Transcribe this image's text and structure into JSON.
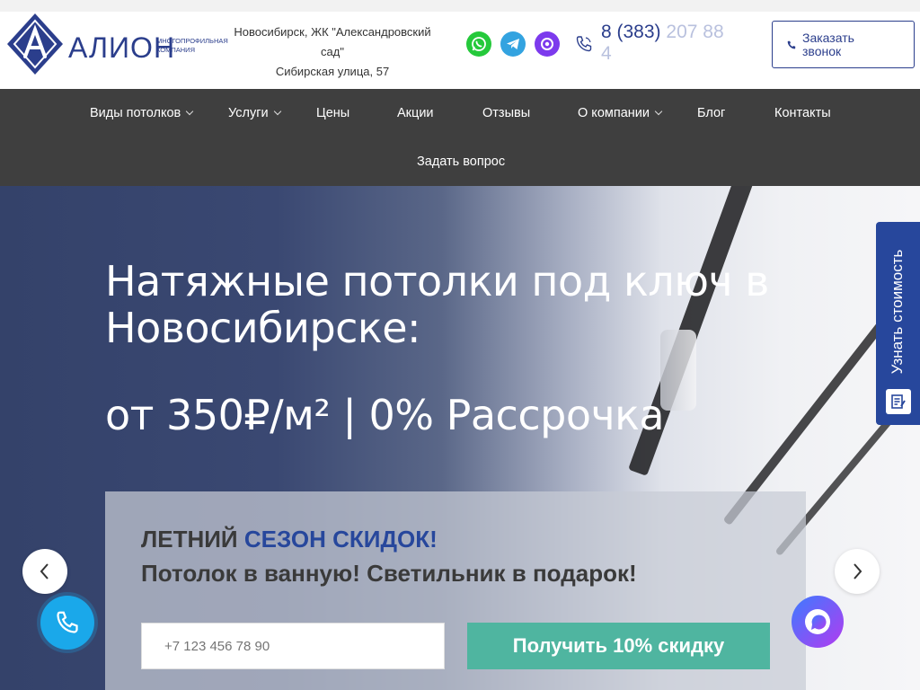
{
  "brand": {
    "name": "АЛИОН",
    "tagline_line1": "многопрофильная",
    "tagline_line2": "компания",
    "primary_color": "#2b3e8c",
    "accent_color": "#27479c"
  },
  "header": {
    "address_line1": "Новосибирск, ЖК \"Александровский сад\"",
    "address_line2": "Сибирская улица, 57",
    "socials": [
      {
        "name": "whatsapp-icon"
      },
      {
        "name": "telegram-icon"
      },
      {
        "name": "max-icon"
      }
    ],
    "phone_main": "8 (383)",
    "phone_faded": "207 88",
    "phone_tail": "4",
    "callback_label": "Заказать звонок"
  },
  "nav": {
    "items": [
      {
        "label": "Виды потолков",
        "dropdown": true
      },
      {
        "label": "Услуги",
        "dropdown": true
      },
      {
        "label": "Цены",
        "dropdown": false
      },
      {
        "label": "Акции",
        "dropdown": false
      },
      {
        "label": "Отзывы",
        "dropdown": false
      },
      {
        "label": "О компании",
        "dropdown": true
      },
      {
        "label": "Блог",
        "dropdown": false
      },
      {
        "label": "Контакты",
        "dropdown": false
      },
      {
        "label": "Задать вопрос",
        "dropdown": false
      }
    ]
  },
  "hero": {
    "title": "Натяжные потолки под ключ в Новосибирске:",
    "price_line": "от 350₽/м² | 0% Рассрочка",
    "promo": {
      "line1_prefix": "ЛЕТНИЙ",
      "line1_highlight": "СЕЗОН СКИДОК!",
      "line2": "Потолок в ванную! Светильник в подарок!",
      "phone_placeholder": "+7 123 456 78 90",
      "submit_label": "Получить 10% скидку",
      "button_color": "#4fb5a0"
    },
    "side_tab_label": "Узнать стоимость"
  }
}
